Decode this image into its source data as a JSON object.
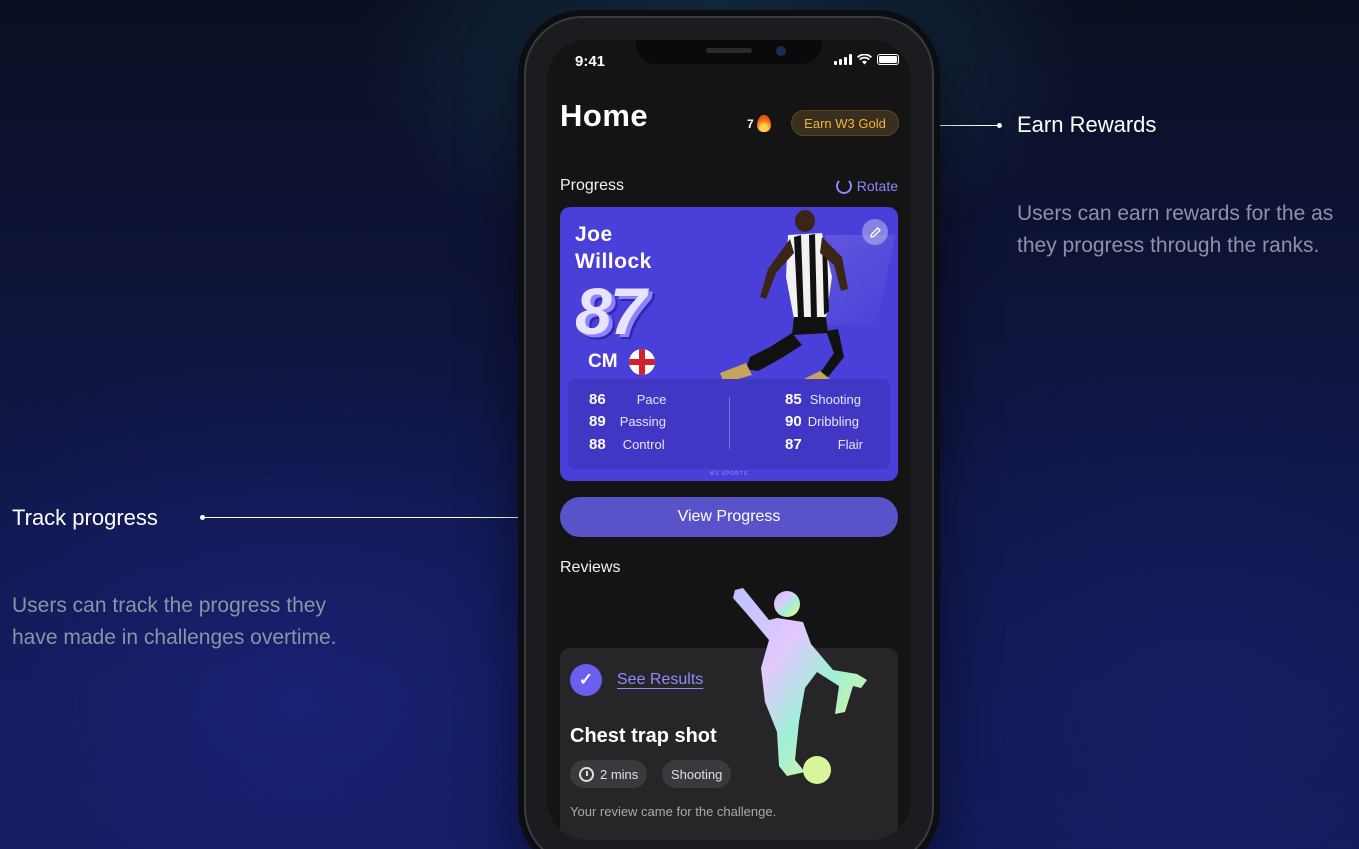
{
  "annotations": {
    "rewards": {
      "title": "Earn Rewards",
      "description": "Users can earn rewards for the as they progress through the ranks."
    },
    "progress": {
      "title": "Track progress",
      "description": "Users can track the progress they have made in challenges overtime."
    }
  },
  "status_bar": {
    "time": "9:41"
  },
  "header": {
    "title": "Home",
    "streak_count": "7",
    "earn_button": "Earn W3 Gold"
  },
  "progress": {
    "label": "Progress",
    "rotate_label": "Rotate",
    "card": {
      "first_name": "Joe",
      "last_name": "Willock",
      "rating": "87",
      "position": "CM",
      "stats": [
        {
          "value": "86",
          "label": "Pace"
        },
        {
          "value": "89",
          "label": "Passing"
        },
        {
          "value": "88",
          "label": "Control"
        },
        {
          "value": "85",
          "label": "Shooting"
        },
        {
          "value": "90",
          "label": "Dribbling"
        },
        {
          "value": "87",
          "label": "Flair"
        }
      ],
      "footer": "W3 SPORTS"
    },
    "view_button": "View Progress"
  },
  "reviews": {
    "label": "Reviews",
    "card": {
      "see_results": "See Results",
      "title": "Chest trap shot",
      "duration": "2 mins",
      "category": "Shooting",
      "message": "Your review came for the challenge."
    }
  },
  "colors": {
    "accent": "#4a3fd8",
    "button": "#5a52c8",
    "gold": "#f1b43a",
    "link": "#8f8bff"
  }
}
